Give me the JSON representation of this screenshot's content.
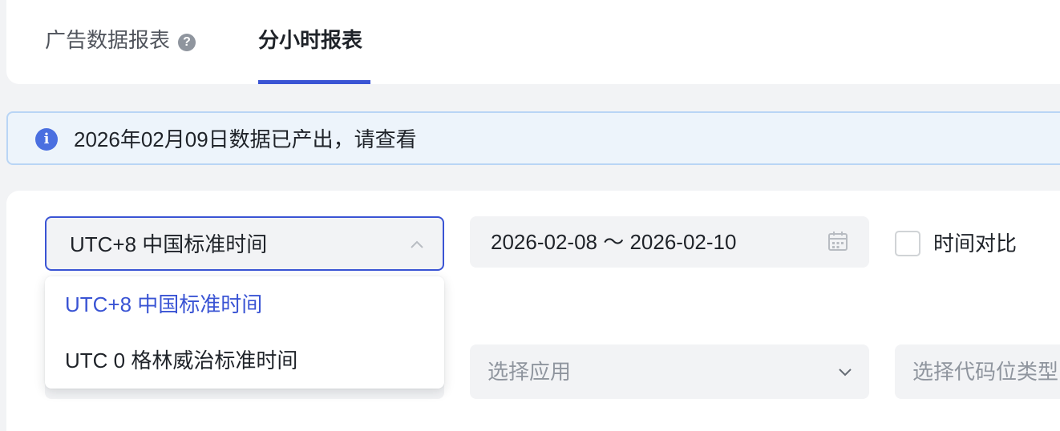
{
  "tabs": {
    "report_label": "广告数据报表",
    "help_glyph": "?",
    "hourly_label": "分小时报表"
  },
  "alert": {
    "icon_glyph": "i",
    "text": "2026年02月09日数据已产出，请查看"
  },
  "filters": {
    "timezone": {
      "value": "UTC+8 中国标准时间",
      "options": [
        "UTC+8 中国标准时间",
        "UTC 0 格林威治标准时间"
      ],
      "selected_index": 0
    },
    "date_range": {
      "value": "2026-02-08 ～ 2026-02-10"
    },
    "time_compare": {
      "label": "时间对比",
      "checked": false
    },
    "app_select": {
      "placeholder": "选择应用"
    },
    "slot_type_select": {
      "placeholder": "选择代码位类型"
    }
  },
  "colors": {
    "accent": "#3a54d4",
    "info_bg": "#edf4fb",
    "placeholder": "#8f959e"
  }
}
